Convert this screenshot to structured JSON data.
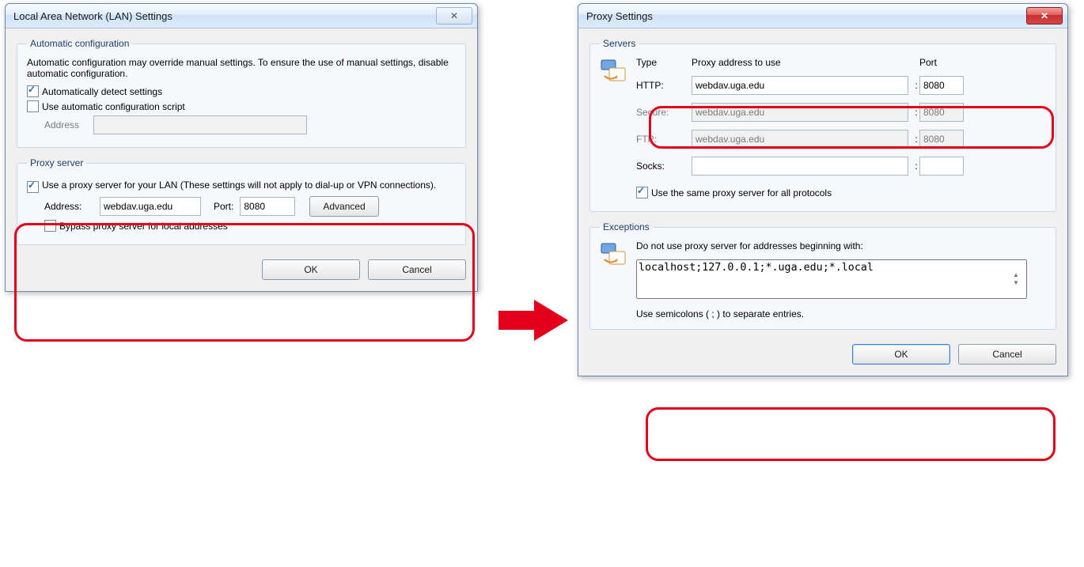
{
  "lan": {
    "title": "Local Area Network (LAN) Settings",
    "close_glyph": "✕",
    "auto": {
      "legend": "Automatic configuration",
      "desc": "Automatic configuration may override manual settings.  To ensure the use of manual settings, disable automatic configuration.",
      "detect_label": "Automatically detect settings",
      "script_label": "Use automatic configuration script",
      "address_label": "Address",
      "address_value": ""
    },
    "proxy": {
      "legend": "Proxy server",
      "use_label": "Use a proxy server for your LAN (These settings will not apply to dial-up or VPN connections).",
      "address_label": "Address:",
      "address_value": "webdav.uga.edu",
      "port_label": "Port:",
      "port_value": "8080",
      "advanced_label": "Advanced",
      "bypass_label": "Bypass proxy server for local addresses"
    },
    "ok_label": "OK",
    "cancel_label": "Cancel"
  },
  "proxy": {
    "title": "Proxy Settings",
    "close_glyph": "✕",
    "servers": {
      "legend": "Servers",
      "header_type": "Type",
      "header_addr": "Proxy address to use",
      "header_port": "Port",
      "rows": [
        {
          "label": "HTTP:",
          "addr": "webdav.uga.edu",
          "port": "8080",
          "enabled": true
        },
        {
          "label": "Secure:",
          "addr": "webdav.uga.edu",
          "port": "8080",
          "enabled": false
        },
        {
          "label": "FTP:",
          "addr": "webdav.uga.edu",
          "port": "8080",
          "enabled": false
        },
        {
          "label": "Socks:",
          "addr": "",
          "port": "",
          "enabled": true
        }
      ],
      "same_label": "Use the same proxy server for all protocols"
    },
    "exc": {
      "legend": "Exceptions",
      "desc": "Do not use proxy server for addresses beginning with:",
      "value": "localhost;127.0.0.1;*.uga.edu;*.local",
      "hint": "Use semicolons ( ; ) to separate entries."
    },
    "ok_label": "OK",
    "cancel_label": "Cancel"
  },
  "colors": {
    "highlight": "#e3001b"
  }
}
